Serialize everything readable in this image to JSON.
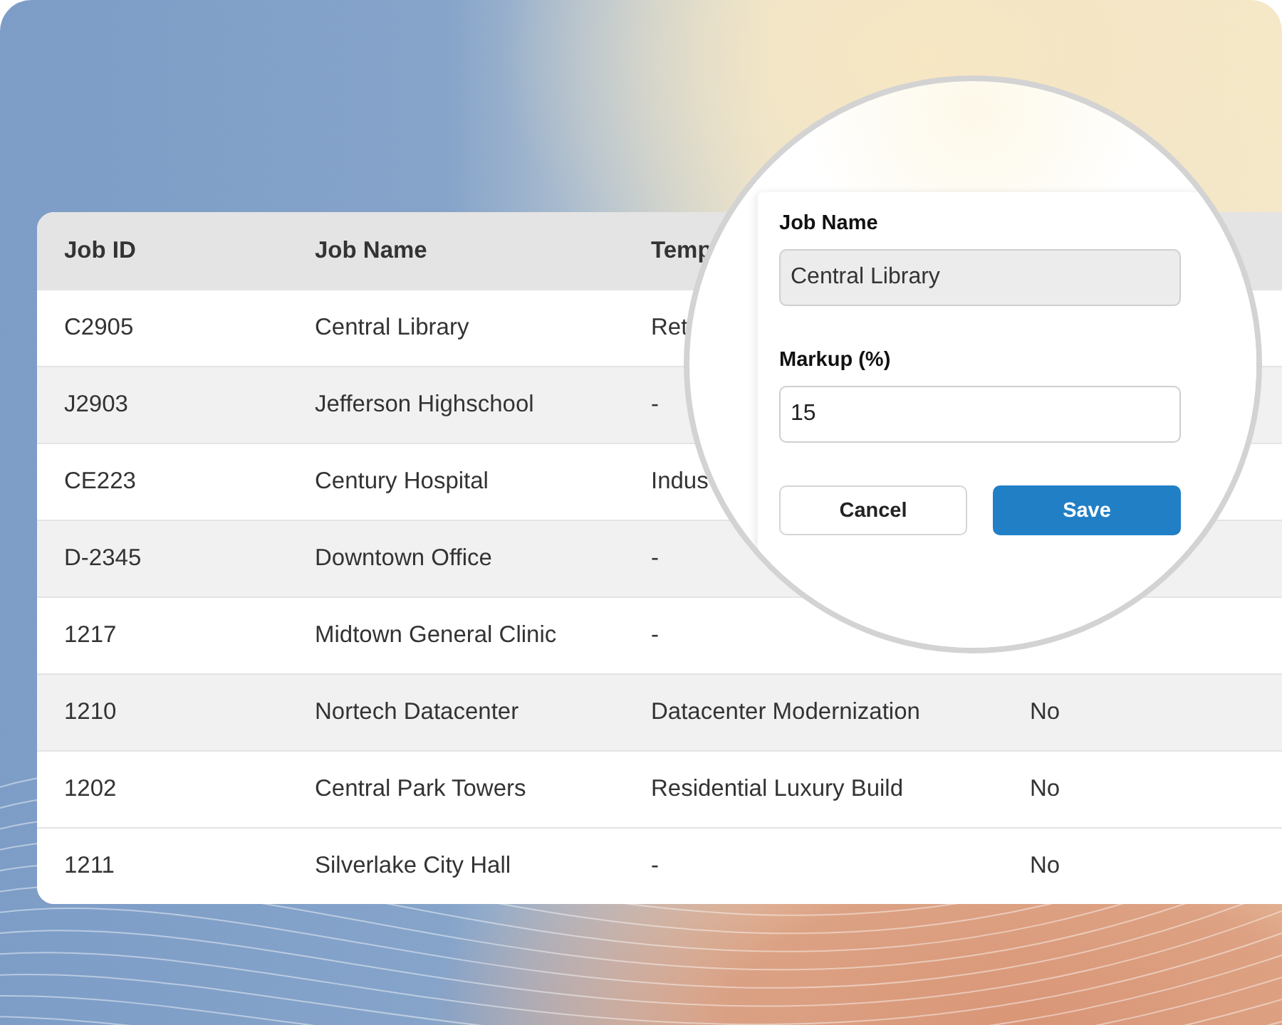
{
  "table": {
    "columns": [
      "Job ID",
      "Job Name",
      "Temp"
    ],
    "rows": [
      {
        "job_id": "C2905",
        "job_name": "Central Library",
        "template": "Ret",
        "shaded": false
      },
      {
        "job_id": "J2903",
        "job_name": "Jefferson Highschool",
        "template": "-",
        "shaded": true
      },
      {
        "job_id": "CE223",
        "job_name": "Century Hospital",
        "template": "Indus",
        "shaded": false
      },
      {
        "job_id": "D-2345",
        "job_name": "Downtown Office",
        "template": "-",
        "shaded": true
      },
      {
        "job_id": "1217",
        "job_name": "Midtown General Clinic",
        "template": "-",
        "shaded": false
      },
      {
        "job_id": "1210",
        "job_name": "Nortech Datacenter",
        "template": "Datacenter Modernization",
        "column_4": "No",
        "shaded": true
      },
      {
        "job_id": "1202",
        "job_name": "Central Park Towers",
        "template": "Residential Luxury Build",
        "column_4": "No",
        "shaded": false
      },
      {
        "job_id": "1211",
        "job_name": "Silverlake City Hall",
        "template": "-",
        "column_4": "No",
        "shaded": false
      }
    ]
  },
  "edit_form": {
    "fields": [
      {
        "label": "Job Name",
        "value": "Central Library",
        "disabled": true
      },
      {
        "label": "Markup (%)",
        "value": "15",
        "disabled": false
      }
    ],
    "buttons": [
      {
        "label": "Cancel",
        "kind": "secondary"
      },
      {
        "label": "Save",
        "kind": "primary"
      }
    ]
  }
}
